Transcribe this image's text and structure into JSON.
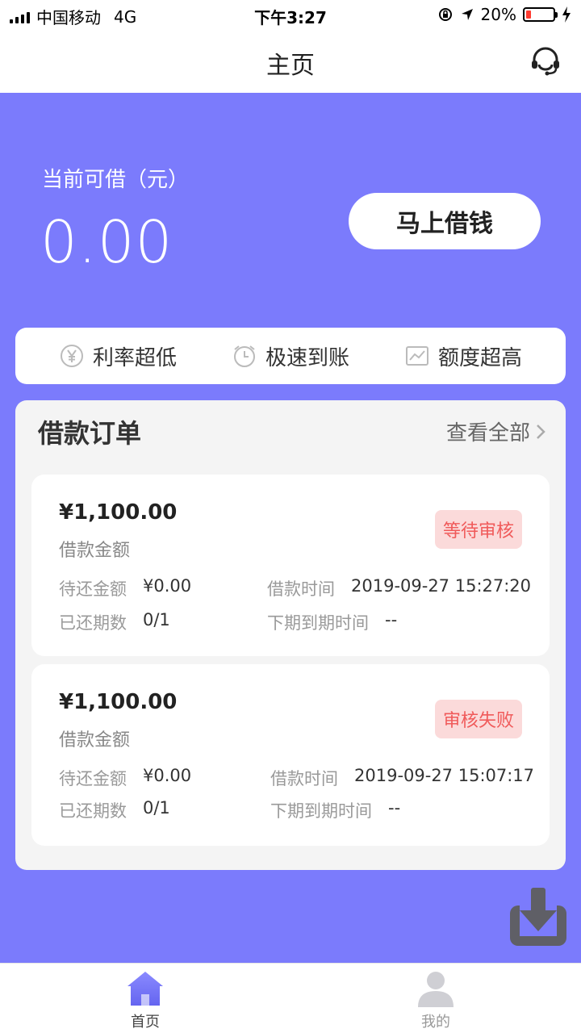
{
  "status_bar": {
    "carrier": "中国移动",
    "network": "4G",
    "time": "下午3:27",
    "battery": "20%",
    "battery_level": 0.2
  },
  "nav": {
    "title": "主页",
    "cs_icon": "headset-icon"
  },
  "hero": {
    "label": "当前可借（元）",
    "amount": "0.00",
    "borrow_button": "马上借钱"
  },
  "features": [
    {
      "label": "利率超低",
      "icon": "yen-coin-icon"
    },
    {
      "label": "极速到账",
      "icon": "clock-icon"
    },
    {
      "label": "额度超高",
      "icon": "chart-icon"
    }
  ],
  "orders": {
    "title": "借款订单",
    "view_all": "查看全部",
    "items": [
      {
        "amount": "¥1,100.00",
        "amount_label": "借款金额",
        "status": "等待审核",
        "due_label": "待还金额",
        "due_value": "¥0.00",
        "time_label": "借款时间",
        "time_value": "2019-09-27 15:27:20",
        "periods_label": "已还期数",
        "periods_value": "0/1",
        "next_label": "下期到期时间",
        "next_value": "--"
      },
      {
        "amount": "¥1,100.00",
        "amount_label": "借款金额",
        "status": "审核失败",
        "due_label": "待还金额",
        "due_value": "¥0.00",
        "time_label": "借款时间",
        "time_value": "2019-09-27 15:07:17",
        "periods_label": "已还期数",
        "periods_value": "0/1",
        "next_label": "下期到期时间",
        "next_value": "--"
      }
    ]
  },
  "tabs": [
    {
      "label": "首页",
      "icon": "home-icon",
      "active": true
    },
    {
      "label": "我的",
      "icon": "user-icon",
      "active": false
    }
  ],
  "colors": {
    "primary": "#7B7BFC",
    "badge_bg": "#FBDADA",
    "badge_text": "#F05A5A"
  }
}
